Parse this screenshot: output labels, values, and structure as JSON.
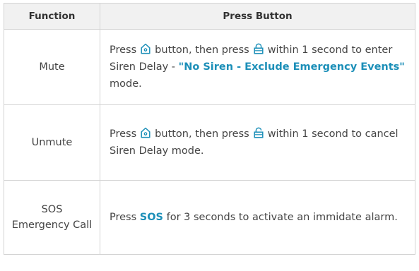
{
  "table": {
    "headers": {
      "function": "Function",
      "press_button": "Press Button"
    },
    "rows": [
      {
        "function": "Mute",
        "text_1": "Press",
        "text_2": "button, then press",
        "text_3": "within 1 second to enter Siren Delay - ",
        "highlight": "\"No Siren - Exclude Emergency Events\"",
        "text_4": " mode."
      },
      {
        "function": "Unmute",
        "text_1": "Press",
        "text_2": "button, then press",
        "text_3": "within 1 second to cancel Siren Delay mode."
      },
      {
        "function_line1": "SOS",
        "function_line2": "Emergency Call",
        "text_1": "Press ",
        "highlight": "SOS",
        "text_2": " for 3 seconds to activate an immidate alarm."
      }
    ]
  },
  "colors": {
    "accent": "#1c8fb8",
    "header_bg": "#f1f1f1",
    "border": "#d3d3d3"
  },
  "icons": {
    "home": "home-icon",
    "lock": "lock-icon",
    "unlock": "unlock-icon"
  }
}
